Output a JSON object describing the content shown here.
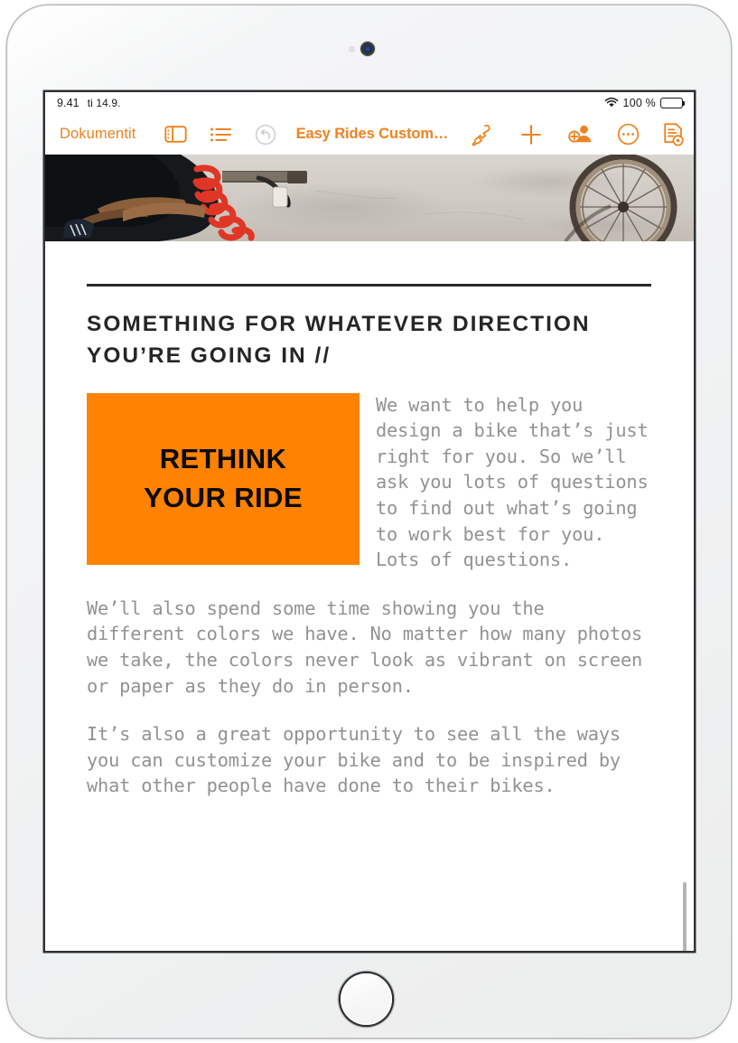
{
  "device": {
    "name": "iPad",
    "camera_icon": "front-camera",
    "sensor_icon": "ambient-light-sensor",
    "home_button_label": "Home"
  },
  "status_bar": {
    "time": "9.41",
    "date": "ti 14.9.",
    "wifi_icon": "wifi-icon",
    "battery_percent": "100 %",
    "battery_icon": "battery-full-icon"
  },
  "toolbar": {
    "documents_label": "Dokumentit",
    "title": "Easy Rides Custom…",
    "icons": [
      {
        "name": "sidebar-icon",
        "label": "Näytä sivupalkki",
        "state": "active"
      },
      {
        "name": "list-view-icon",
        "label": "Sisällysluettelo",
        "state": "active"
      },
      {
        "name": "undo-icon",
        "label": "Kumoa",
        "state": "disabled"
      },
      {
        "name": "format-brush-icon",
        "label": "Muotoilu",
        "state": "active"
      },
      {
        "name": "insert-plus-icon",
        "label": "Lisää",
        "state": "active"
      },
      {
        "name": "add-collaborator-icon",
        "label": "Yhteistyö",
        "state": "active"
      },
      {
        "name": "more-options-icon",
        "label": "Lisää vaihtoehtoja",
        "state": "active"
      },
      {
        "name": "document-preview-icon",
        "label": "Asiakirjan esikatselu",
        "state": "active"
      }
    ]
  },
  "document": {
    "hero_image_alt": "Cyclist crouching with a red coiled bike pump hose beside a bicycle wheel on pavement",
    "heading": "SOMETHING FOR WHATEVER DIRECTION YOU’RE GOING IN //",
    "callout": {
      "line1": "RETHINK",
      "line2": "YOUR RIDE",
      "background_color": "#ff8200",
      "text_color": "#0a0a0a"
    },
    "paragraphs": [
      "We want to help you design a bike that’s just right for you. So we’ll ask you lots of questions to find out what’s going to work best for you. Lots of questions.",
      "We’ll also spend some time showing you the different colors we have. No matter how many photos we take, the colors never look as vibrant on screen or paper as they do in person.",
      "It’s also a great opportunity to see all the ways you can customize your bike and to be inspired by what other people have done to their bikes."
    ]
  },
  "colors": {
    "accent_orange": "#f0821f",
    "callout_orange": "#ff8200",
    "body_text_gray": "#929292",
    "heading_dark": "#262626",
    "disabled_gray": "#c9c9c9"
  },
  "scrollbar": {
    "name": "vertical-scroll-indicator"
  }
}
